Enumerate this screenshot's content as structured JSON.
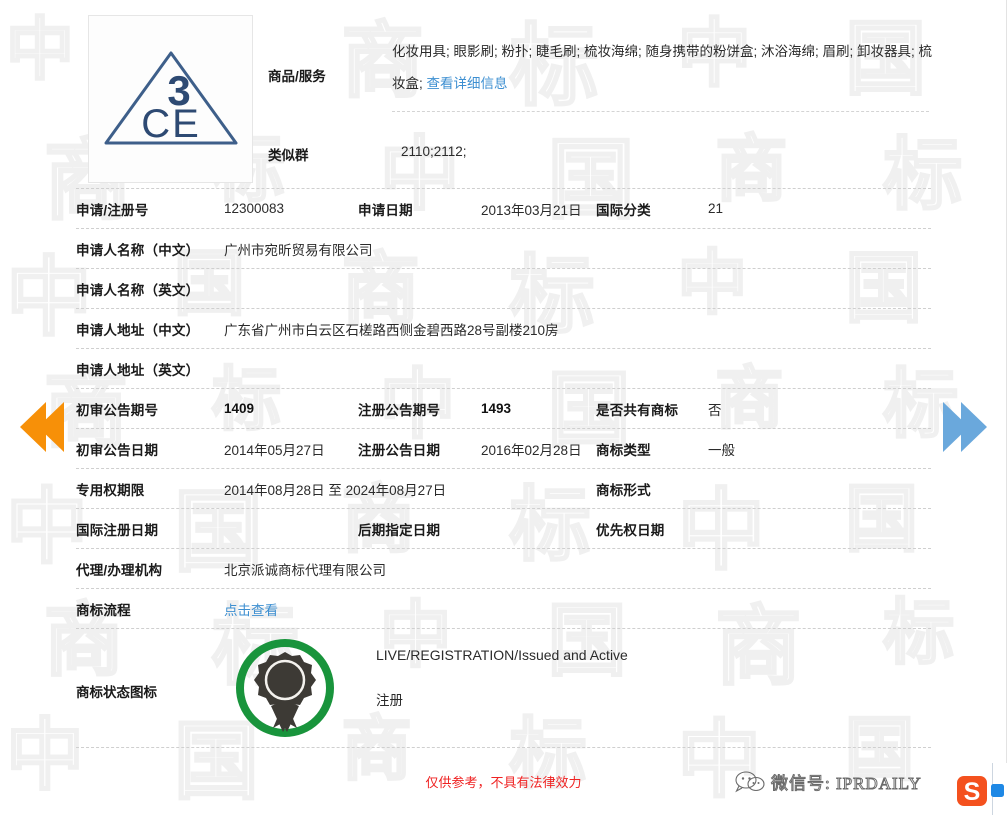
{
  "trademark": {
    "logo_alt": "3CE triangle trademark logo",
    "logo_text_top": "3",
    "logo_text_bottom": "CE",
    "logo_stroke_color": "#3e5f8a"
  },
  "goods": {
    "label": "商品/服务",
    "value": "化妆用具; 眼影刷; 粉扑; 睫毛刷; 梳妆海绵; 随身携带的粉饼盒; 沐浴海绵; 眉刷; 卸妆器具; 梳妆盒; ",
    "detail_link": "查看详细信息"
  },
  "similar_group": {
    "label": "类似群",
    "value": "2110;2112;"
  },
  "rows": [
    {
      "c1_label": "申请/注册号",
      "c1_value": "12300083",
      "c2_label": "申请日期",
      "c2_value": "2013年03月21日",
      "c3_label": "国际分类",
      "c3_value": "21"
    },
    {
      "c1_label": "申请人名称（中文）",
      "c1_value": "广州市宛昕贸易有限公司",
      "c2_label": "",
      "c2_value": "",
      "c3_label": "",
      "c3_value": ""
    },
    {
      "c1_label": "申请人名称（英文）",
      "c1_value": "",
      "c2_label": "",
      "c2_value": "",
      "c3_label": "",
      "c3_value": ""
    },
    {
      "c1_label": "申请人地址（中文）",
      "c1_value": "广东省广州市白云区石槎路西侧金碧西路28号副楼210房",
      "c2_label": "",
      "c2_value": "",
      "c3_label": "",
      "c3_value": ""
    },
    {
      "c1_label": "申请人地址（英文）",
      "c1_value": "",
      "c2_label": "",
      "c2_value": "",
      "c3_label": "",
      "c3_value": ""
    },
    {
      "c1_label": "初审公告期号",
      "c1_value": "1409",
      "c2_label": "注册公告期号",
      "c2_value": "1493",
      "c3_label": "是否共有商标",
      "c3_value": "否"
    },
    {
      "c1_label": "初审公告日期",
      "c1_value": "2014年05月27日",
      "c2_label": "注册公告日期",
      "c2_value": "2016年02月28日",
      "c3_label": "商标类型",
      "c3_value": "一般"
    },
    {
      "c1_label": "专用权期限",
      "c1_value": "2014年08月28日 至 2024年08月27日",
      "c2_label": "",
      "c2_value": "",
      "c3_label": "商标形式",
      "c3_value": ""
    },
    {
      "c1_label": "国际注册日期",
      "c1_value": "",
      "c2_label": "后期指定日期",
      "c2_value": "",
      "c3_label": "优先权日期",
      "c3_value": ""
    },
    {
      "c1_label": "代理/办理机构",
      "c1_value": "北京派诚商标代理有限公司",
      "c2_label": "",
      "c2_value": "",
      "c3_label": "",
      "c3_value": ""
    }
  ],
  "process": {
    "label": "商标流程",
    "link_text": "点击查看"
  },
  "status": {
    "label": "商标状态图标",
    "icon_name": "award-ribbon-icon",
    "ring_color": "#19943c",
    "medal_color": "#3d3a35",
    "primary_text": "LIVE/REGISTRATION/Issued and Active",
    "secondary_text": "注册"
  },
  "disclaimer": "仅供参考，不具有法律效力",
  "watermark": {
    "wechat_text": "微信号: IPRDAILY",
    "background_chars": [
      "中",
      "国",
      "商",
      "标"
    ]
  },
  "navigation": {
    "prev_label": "上一个",
    "next_label": "下一个",
    "prev_color": "#f79008",
    "next_color": "#6aa8dc"
  },
  "browser": {
    "sogou_label": "S"
  }
}
